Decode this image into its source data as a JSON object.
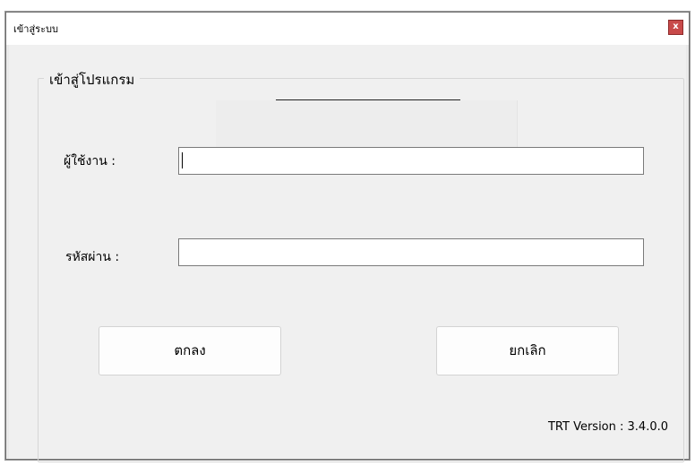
{
  "window": {
    "title": "เข้าสู่ระบบ",
    "close_label": "x"
  },
  "group": {
    "title": "เข้าสู่โปรแกรม"
  },
  "form": {
    "username_label": "ผู้ใช้งาน :",
    "username_value": "",
    "password_label": "รหัสผ่าน :",
    "password_value": ""
  },
  "buttons": {
    "ok_label": "ตกลง",
    "cancel_label": "ยกเลิก"
  },
  "footer": {
    "version": "TRT Version : 3.4.0.0"
  },
  "colors": {
    "close_button": "#c84a4a",
    "background": "#f0f0f0"
  }
}
